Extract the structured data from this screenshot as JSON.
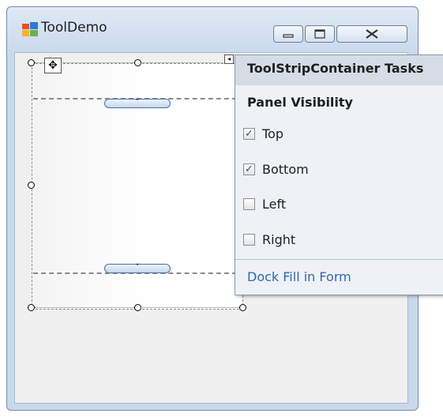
{
  "window": {
    "title": "ToolDemo",
    "icon": "form-icon",
    "buttons": [
      "minimize-icon",
      "maximize-icon",
      "close-icon"
    ]
  },
  "designer": {
    "top_panel_toggle": "˄",
    "bottom_panel_toggle": "˅",
    "move_glyph": "✥",
    "smart_tag_glyph": "◂"
  },
  "tasks": {
    "header": "ToolStripContainer Tasks",
    "section": "Panel Visibility",
    "options": [
      {
        "label": "Top",
        "checked": true
      },
      {
        "label": "Bottom",
        "checked": true
      },
      {
        "label": "Left",
        "checked": false
      },
      {
        "label": "Right",
        "checked": false
      }
    ],
    "link": "Dock Fill in Form"
  },
  "colors": {
    "link": "#3366aa",
    "checkmark": "#2a4f8f",
    "header_bg": "#d5dce6"
  }
}
